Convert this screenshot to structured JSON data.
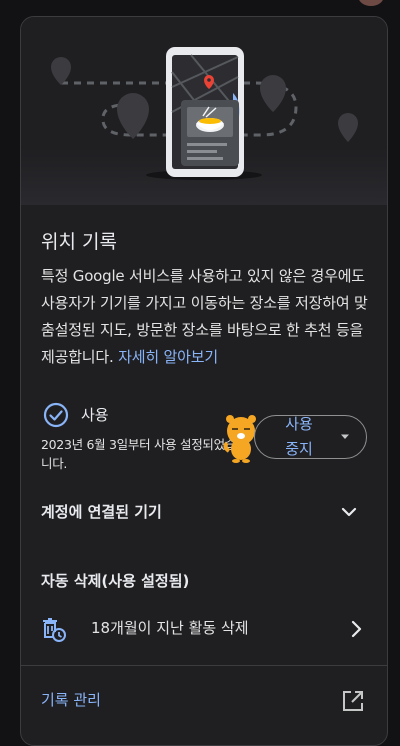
{
  "card": {
    "title": "위치 기록",
    "description": "특정 Google 서비스를 사용하고 있지 않은 경우에도 사용자가 기기를 가지고 이동하는 장소를 저장하여 맞춤설정된 지도, 방문한 장소를 바탕으로 한 추천 등을 제공합니다.",
    "learn_more_link": "자세히 알아보기"
  },
  "status": {
    "label": "사용",
    "date_text": "2023년 6월 3일부터 사용 설정되었습니다."
  },
  "pause_button": {
    "label": "사용 중지"
  },
  "devices": {
    "label": "계정에 연결된 기기"
  },
  "auto_delete": {
    "title": "자동 삭제(사용 설정됨)",
    "item_label": "18개월이 지난 활동 삭제"
  },
  "manage": {
    "label": "기록 관리"
  },
  "colors": {
    "accent": "#8ab4f8",
    "background": "#1f1f22",
    "text": "#e8eaed"
  },
  "icons": {
    "status": "check-circle-icon",
    "pause_caret": "caret-down-icon",
    "devices_chevron": "chevron-down-icon",
    "auto_delete": "delete-history-icon",
    "auto_delete_chevron": "chevron-right-icon",
    "manage": "open-in-new-icon"
  }
}
